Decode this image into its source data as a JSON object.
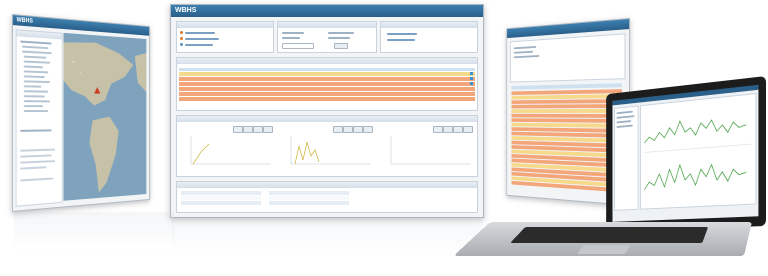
{
  "main_window": {
    "title": "WBHS"
  },
  "colors": {
    "accent": "#2a5f8a",
    "row_orange": "#f3a67a",
    "row_yellow": "#f7d98b",
    "row_blue": "#cfe0ef",
    "map_water": "#7fa3bd",
    "map_land": "#c7c1a8"
  }
}
